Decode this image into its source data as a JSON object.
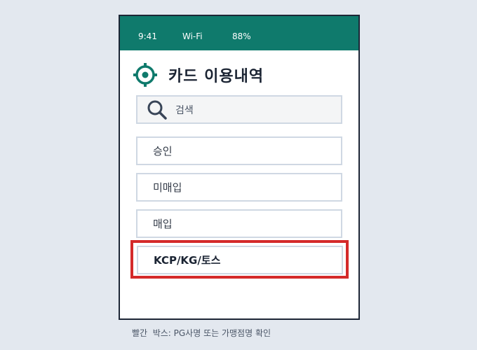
{
  "status_bar": {
    "time": "9:41",
    "network": "Wi-Fi",
    "battery": "88%"
  },
  "header": {
    "icon": "target-icon",
    "title": "카드 이용내역"
  },
  "search": {
    "icon": "search-icon",
    "placeholder": "검색"
  },
  "options": [
    {
      "label": "승인"
    },
    {
      "label": "미매입"
    },
    {
      "label": "매입"
    },
    {
      "label": "KCP/KG/토스",
      "highlighted": true
    }
  ],
  "caption": "빨간  박스: PG사명 또는 가맹점명 확인",
  "colors": {
    "status_bar": "#0f7a6c",
    "accent": "#0f7a6c",
    "highlight_border": "#d42a2a",
    "background": "#e3e8ef",
    "frame": "#1d2636"
  }
}
